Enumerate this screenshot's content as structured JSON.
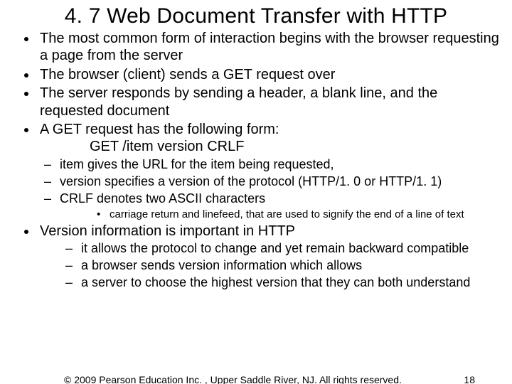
{
  "title": "4. 7  Web Document Transfer with HTTP",
  "bullets": {
    "b0": "The most common form of interaction begins with the browser requesting a page from the server",
    "b1": "The browser (client) sends a GET request over",
    "b2": "The server responds by sending a header, a blank line, and the requested document",
    "b3": "A GET request has the following form:",
    "b3_code": "GET /item version CRLF",
    "b3_sub0": "item gives the URL for the item being requested,",
    "b3_sub1": "version specifies a version of the protocol (HTTP/1. 0 or HTTP/1. 1)",
    "b3_sub2": "CRLF denotes two ASCII characters",
    "b3_sub2_sub0": "carriage return and linefeed, that are used to signify the end of a line of text",
    "b4": "Version information is important in HTTP",
    "b4_sub0": "it allows the protocol to change and yet remain backward compatible",
    "b4_sub1": "a browser sends version information which allows",
    "b4_sub2": "a server to choose the highest version that they can both understand"
  },
  "footer": {
    "copyright": "© 2009 Pearson Education Inc. , Upper Saddle River, NJ. All rights reserved.",
    "page": "18"
  }
}
